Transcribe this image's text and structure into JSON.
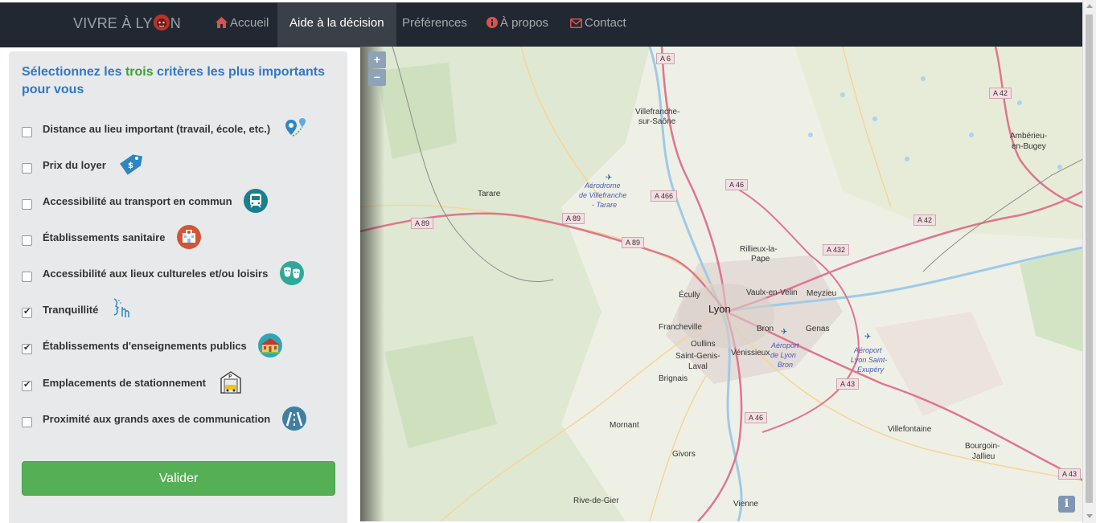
{
  "navbar": {
    "brand_before": "VIVRE À LY",
    "brand_after": "N",
    "items": [
      {
        "label": "Accueil",
        "icon": "home-icon"
      },
      {
        "label": "Aide à la décision",
        "active": true
      },
      {
        "label": "Préférences"
      },
      {
        "label": "À propos",
        "icon": "info-circle-icon"
      },
      {
        "label": "Contact",
        "icon": "envelope-icon"
      }
    ]
  },
  "panel": {
    "title_part1": "Sélectionnez les ",
    "title_highlight": "trois",
    "title_part2": " critères les plus importants pour vous",
    "criteria": [
      {
        "label": "Distance au lieu important (travail, école, etc.)",
        "checked": false,
        "icon": "route-pin-icon"
      },
      {
        "label": "Prix du loyer",
        "checked": false,
        "icon": "price-tag-icon"
      },
      {
        "label": "Accessibilité au transport en commun",
        "checked": false,
        "icon": "tram-icon"
      },
      {
        "label": "Établissements sanitaire",
        "checked": false,
        "icon": "hospital-icon"
      },
      {
        "label": "Accessibilité aux lieux cultureles et/ou loisirs",
        "checked": false,
        "icon": "theater-masks-icon"
      },
      {
        "label": "Tranquillité",
        "checked": true,
        "icon": "quiet-gesture-icon"
      },
      {
        "label": "Établissements d'enseignements publics",
        "checked": true,
        "icon": "school-icon"
      },
      {
        "label": "Emplacements de stationnement",
        "checked": true,
        "icon": "parking-garage-icon"
      },
      {
        "label": "Proximité aux grands axes de communication",
        "checked": false,
        "icon": "highway-icon"
      }
    ],
    "submit_label": "Valider"
  },
  "map": {
    "zoom_in": "+",
    "zoom_out": "−",
    "info": "i",
    "labels": [
      {
        "text": "Villefranche-"
      },
      {
        "text": "sur-Saône"
      },
      {
        "text": "Tarare"
      },
      {
        "text": "Aérodrome"
      },
      {
        "text": "de Villefranche"
      },
      {
        "text": "- Tarare"
      },
      {
        "text": "Rillieux-la-"
      },
      {
        "text": "Pape"
      },
      {
        "text": "Vaulx-en-Velin"
      },
      {
        "text": "Meyzieu"
      },
      {
        "text": "Écully"
      },
      {
        "text": "Lyon"
      },
      {
        "text": "Francheville"
      },
      {
        "text": "Bron"
      },
      {
        "text": "Genas"
      },
      {
        "text": "Oullins"
      },
      {
        "text": "Aéroport"
      },
      {
        "text": "de Lyon"
      },
      {
        "text": "Bron"
      },
      {
        "text": "Aéroport"
      },
      {
        "text": "Lyon Saint-"
      },
      {
        "text": "Exupéry"
      },
      {
        "text": "Saint-Genis-"
      },
      {
        "text": "Laval"
      },
      {
        "text": "Vénissieux"
      },
      {
        "text": "Brignais"
      },
      {
        "text": "Ambérieu-"
      },
      {
        "text": "en-Bugey"
      },
      {
        "text": "Mornant"
      },
      {
        "text": "Villefontaine"
      },
      {
        "text": "Bourgoin-"
      },
      {
        "text": "Jallieu"
      },
      {
        "text": "Givors"
      },
      {
        "text": "Rive-de-Gier"
      },
      {
        "text": "Vienne"
      }
    ],
    "shields": [
      {
        "text": "A 6"
      },
      {
        "text": "A 42"
      },
      {
        "text": "A 466"
      },
      {
        "text": "A 46"
      },
      {
        "text": "A 89"
      },
      {
        "text": "A 89"
      },
      {
        "text": "A 89"
      },
      {
        "text": "A 42"
      },
      {
        "text": "A 432"
      },
      {
        "text": "A 43"
      },
      {
        "text": "A 46"
      },
      {
        "text": "A 43"
      }
    ]
  }
}
